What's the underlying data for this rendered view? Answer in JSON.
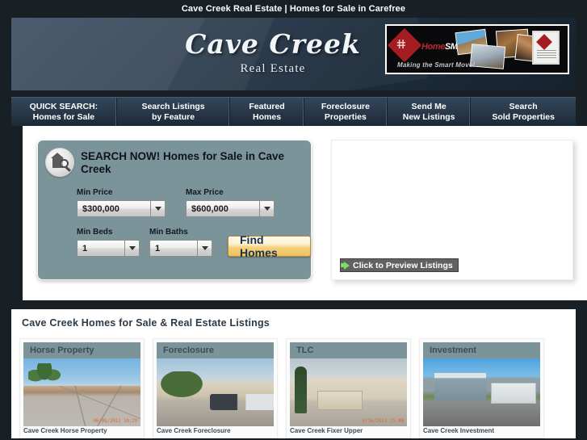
{
  "page": {
    "title": "Cave Creek Real Estate | Homes for Sale in Carefree"
  },
  "header": {
    "brand_name": "Cave Creek",
    "brand_sub": "Real Estate",
    "ad": {
      "logo_prefix": "Home",
      "logo_suffix": "SMART",
      "tagline": "Making the Smart Move!",
      "diamond_glyph": "ⵌ"
    }
  },
  "nav": {
    "items": [
      {
        "line1": "QUICK SEARCH:",
        "line2": "Homes for Sale"
      },
      {
        "line1": "Search Listings",
        "line2": "by Feature"
      },
      {
        "line1": "Featured",
        "line2": "Homes"
      },
      {
        "line1": "Foreclosure",
        "line2": "Properties"
      },
      {
        "line1": "Send Me",
        "line2": "New Listings"
      },
      {
        "line1": "Search",
        "line2": "Sold Properties"
      }
    ]
  },
  "search_panel": {
    "heading": "SEARCH NOW! Homes for Sale in Cave Creek",
    "min_price_label": "Min Price",
    "min_price_value": "$300,000",
    "max_price_label": "Max Price",
    "max_price_value": "$600,000",
    "min_beds_label": "Min Beds",
    "min_beds_value": "1",
    "min_baths_label": "Min Baths",
    "min_baths_value": "1",
    "submit_label": "Find Homes"
  },
  "preview": {
    "button_label": "Click to Preview Listings"
  },
  "listings_section": {
    "title": "Cave Creek Homes for Sale & Real Estate Listings"
  },
  "listings": {
    "cards": [
      {
        "label": "Horse Property",
        "photo_class": "photo1",
        "stamp": "06/08/2011  10:29",
        "caption": "Cave Creek Horse Property"
      },
      {
        "label": "Foreclosure",
        "photo_class": "photo2",
        "stamp": "",
        "caption": "Cave Creek Foreclosure"
      },
      {
        "label": "TLC",
        "photo_class": "photo3",
        "stamp": "6/16/2011  15:48",
        "caption": "Cave Creek Fixer Upper"
      },
      {
        "label": "Investment",
        "photo_class": "photo4",
        "stamp": "",
        "caption": "Cave Creek Investment"
      }
    ]
  },
  "colors": {
    "page_bg": "#182026",
    "header_navy": "#2c4157",
    "panel_teal": "#7b949a",
    "accent_gold": "#f3cf7c",
    "arrow_green": "#7ddb6b",
    "title_slate": "#2b3a46"
  }
}
